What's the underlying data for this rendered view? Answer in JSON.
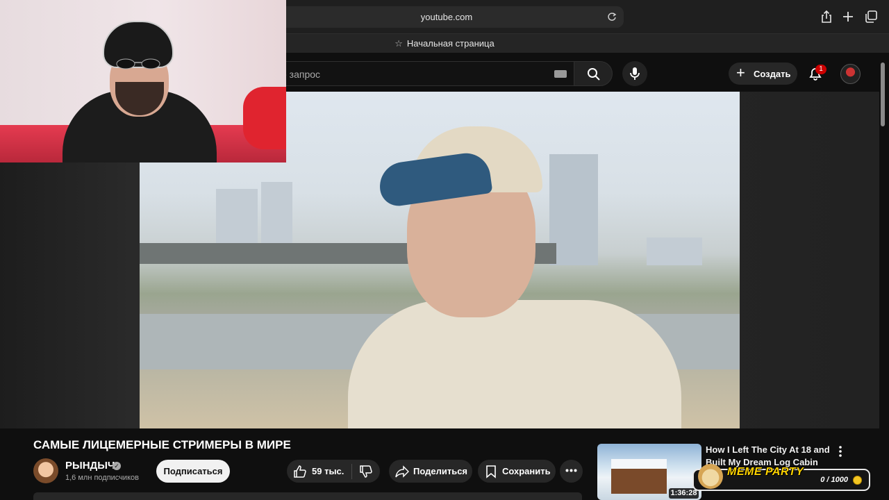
{
  "browser": {
    "url": "youtube.com",
    "tab_title": "Начальная страница"
  },
  "header": {
    "search_placeholder_visible": "е запрос",
    "create_label": "Создать",
    "notification_count": "1"
  },
  "video": {
    "title": "САМЫЕ ЛИЦЕМЕРНЫЕ СТРИМЕРЫ В МИРЕ",
    "channel_name": "РЫНДЫЧ",
    "subscribers": "1,6 млн подписчиков",
    "subscribe_label": "Подписаться",
    "likes": "59 тыс.",
    "share_label": "Поделиться",
    "save_label": "Сохранить"
  },
  "recommended": {
    "title": "How I Left The City At 18 and Built My Dream Log Cabin",
    "duration": "1:36:28"
  },
  "overlay": {
    "meme_title": "MEME PARTY",
    "meme_count": "0 / 1000"
  },
  "icons": {
    "reload": "reload-icon",
    "share": "share-icon",
    "new_tab": "plus-icon",
    "tabs": "tabs-icon",
    "star": "star-icon",
    "search": "search-icon",
    "mic": "mic-icon",
    "bell": "bell-icon",
    "like": "thumbs-up-icon",
    "dislike": "thumbs-down-icon",
    "more": "more-icon",
    "coin": "coin-icon"
  },
  "colors": {
    "background": "#0f0f0f",
    "accent_red": "#cc0000",
    "subscribe_bg": "#f1f1f1",
    "meme_yellow": "#ffd400"
  }
}
